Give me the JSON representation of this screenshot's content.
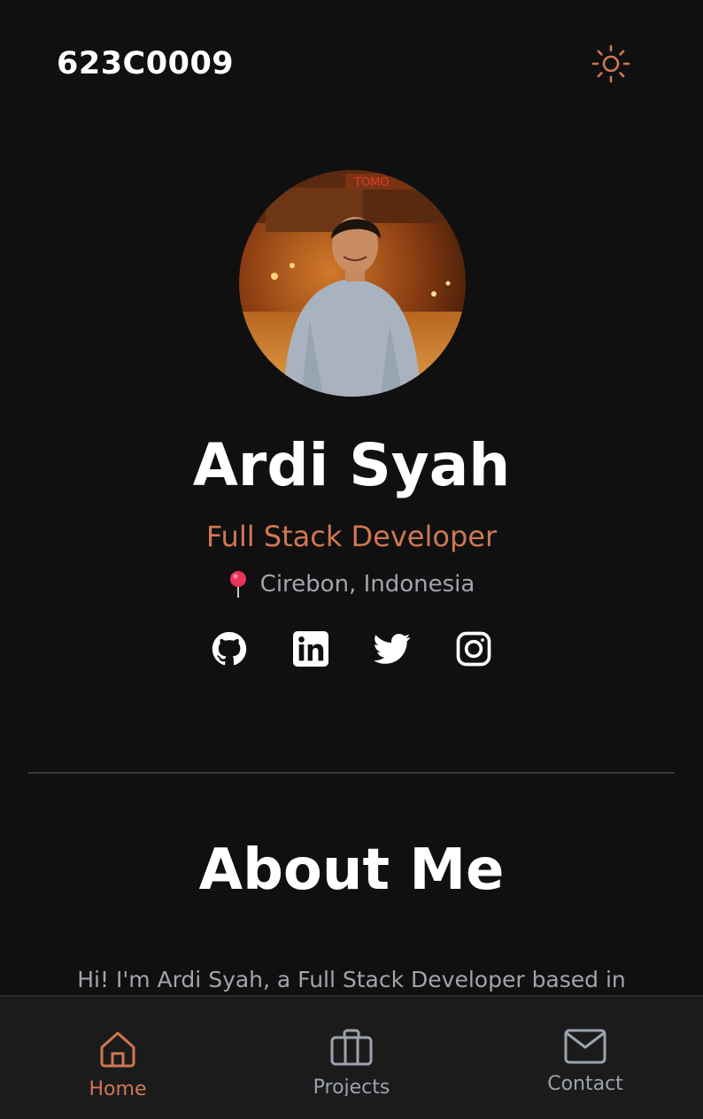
{
  "header": {
    "brand": "623C0009",
    "theme_icon": "sun-icon"
  },
  "profile": {
    "name": "Ardi Syah",
    "role": "Full Stack Developer",
    "location": "Cirebon, Indonesia",
    "location_icon": "map-pin-icon",
    "photo_description": "profile photo"
  },
  "socials": [
    {
      "icon": "github-icon"
    },
    {
      "icon": "linkedin-icon"
    },
    {
      "icon": "twitter-icon"
    },
    {
      "icon": "instagram-icon"
    }
  ],
  "about": {
    "title": "About Me",
    "text": "Hi! I'm Ardi Syah, a Full Stack Developer based in"
  },
  "bottom_nav": {
    "items": [
      {
        "label": "Home",
        "icon": "home-icon",
        "active": true
      },
      {
        "label": "Projects",
        "icon": "briefcase-icon",
        "active": false
      },
      {
        "label": "Contact",
        "icon": "mail-icon",
        "active": false
      }
    ]
  },
  "colors": {
    "background": "#101010",
    "accent": "#cf7752",
    "muted_text": "#a3a3ad",
    "nav_background": "#1b1b1c"
  }
}
